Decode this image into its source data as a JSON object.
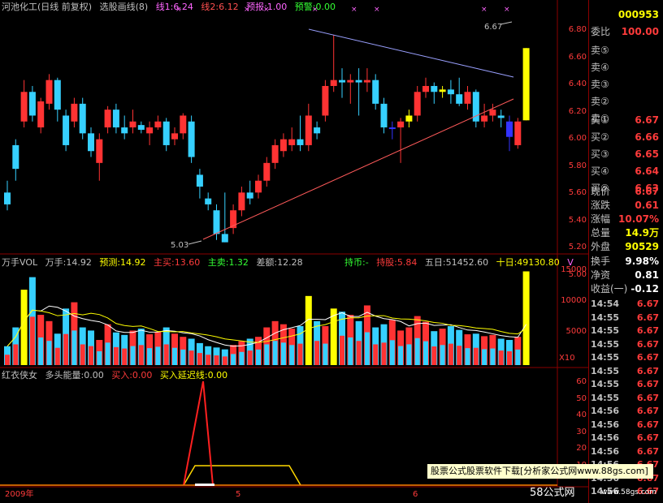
{
  "price_header": {
    "stock": "河池化工(日线 前复权)",
    "indicator": "选股画线(8)",
    "line1": "线1:6.24",
    "line2": "线2:6.12",
    "forecast": "预报:1.00",
    "warning": "预警:0.00"
  },
  "volume_header": {
    "title": "万手VOL",
    "vol": "万手:14.92",
    "pred": "预测:14.92",
    "main_buy": "主买:13.60",
    "main_sell": "主卖:1.32",
    "diff": "差额:12.28",
    "hold": "持币:-",
    "hold_unit": "持股:5.84",
    "ma5": "五日:51452.60",
    "ma10": "十日:49130.80",
    "v": "V"
  },
  "energy_header": {
    "title": "红衣侠女",
    "energy": "多头能量:0.00",
    "buy": "买入:0.00",
    "buy_delay": "买入延迟线:0.00"
  },
  "price_axis": [
    "6.80",
    "6.60",
    "6.40",
    "6.20",
    "6.00",
    "5.80",
    "5.60",
    "5.40",
    "5.20",
    "5.00"
  ],
  "volume_axis": [
    "15000",
    "10000",
    "5000"
  ],
  "volume_unit": "X10",
  "energy_axis": [
    "60",
    "50",
    "40",
    "30",
    "20",
    "10"
  ],
  "annotations": {
    "high": "6.67",
    "low": "5.03"
  },
  "time_axis": {
    "year": "2009年",
    "m5": "5",
    "m6": "6"
  },
  "sidebar": {
    "code": "000953",
    "ratio_label": "委比",
    "ratio_value": "100.00",
    "sells": [
      "卖⑤",
      "卖④",
      "卖③",
      "卖②",
      "卖①"
    ],
    "buys": [
      {
        "label": "买①",
        "value": "6.67"
      },
      {
        "label": "买②",
        "value": "6.66"
      },
      {
        "label": "买③",
        "value": "6.65"
      },
      {
        "label": "买④",
        "value": "6.64"
      },
      {
        "label": "买⑤",
        "value": "6.63"
      }
    ],
    "stats": [
      {
        "label": "现价",
        "value": "6.67"
      },
      {
        "label": "涨跌",
        "value": "0.61"
      },
      {
        "label": "涨幅",
        "value": "10.07%"
      },
      {
        "label": "总量",
        "value": "14.9万"
      },
      {
        "label": "外盘",
        "value": "90529"
      }
    ],
    "stats2": [
      {
        "label": "换手",
        "value": "9.98%"
      },
      {
        "label": "净资",
        "value": "0.81"
      },
      {
        "label": "收益(一)",
        "value": "-0.12"
      }
    ],
    "ticks": [
      {
        "time": "14:54",
        "price": "6.67"
      },
      {
        "time": "14:55",
        "price": "6.67"
      },
      {
        "time": "14:55",
        "price": "6.67"
      },
      {
        "time": "14:55",
        "price": "6.67"
      },
      {
        "time": "14:55",
        "price": "6.67"
      },
      {
        "time": "14:55",
        "price": "6.67"
      },
      {
        "time": "14:55",
        "price": "6.67"
      },
      {
        "time": "14:55",
        "price": "6.67"
      },
      {
        "time": "14:56",
        "price": "6.67"
      },
      {
        "time": "14:56",
        "price": "6.67"
      },
      {
        "time": "14:56",
        "price": "6.67"
      },
      {
        "time": "14:56",
        "price": "6.67"
      },
      {
        "time": "14:56",
        "price": "6.67"
      },
      {
        "time": "14:56",
        "price": "6.67"
      },
      {
        "time": "14:56",
        "price": "6.67"
      }
    ]
  },
  "watermark": "股票公式股票软件下载[分析家公式网www.88gs.com]",
  "site_logo": "58公式网",
  "site_url": "www.58gs.com",
  "colors": {
    "up": "#ff3333",
    "down": "#36d0ff",
    "special": "#ffff00",
    "line_red": "#ff5050",
    "line_blue": "#a0a8ff"
  },
  "chart_data": {
    "type": "candlestick",
    "price_range": [
      5.0,
      6.85
    ],
    "ohlc": [
      [
        5.45,
        5.35,
        5.55,
        5.3
      ],
      [
        5.85,
        5.65,
        5.9,
        5.55
      ],
      [
        6.05,
        6.3,
        6.4,
        6.0
      ],
      [
        6.3,
        6.1,
        6.35,
        6.05
      ],
      [
        6.0,
        6.22,
        6.25,
        5.95
      ],
      [
        6.2,
        6.4,
        6.45,
        6.15
      ],
      [
        6.4,
        6.15,
        6.42,
        6.05
      ],
      [
        6.1,
        5.85,
        6.15,
        5.8
      ],
      [
        6.05,
        6.2,
        6.25,
        6.0
      ],
      [
        6.2,
        5.95,
        6.25,
        5.9
      ],
      [
        5.95,
        5.8,
        6.0,
        5.75
      ],
      [
        5.7,
        5.9,
        5.95,
        5.55
      ],
      [
        6.0,
        6.15,
        6.18,
        5.95
      ],
      [
        6.15,
        6.0,
        6.2,
        5.95
      ],
      [
        6.0,
        5.95,
        6.1,
        5.9
      ],
      [
        6.0,
        6.05,
        6.15,
        5.95
      ],
      [
        6.02,
        5.98,
        6.05,
        5.95
      ],
      [
        5.95,
        6.0,
        6.05,
        5.85
      ],
      [
        6.0,
        6.05,
        6.1,
        5.98
      ],
      [
        6.05,
        5.85,
        6.08,
        5.8
      ],
      [
        5.9,
        5.95,
        6.0,
        5.85
      ],
      [
        5.95,
        6.1,
        6.12,
        5.9
      ],
      [
        6.05,
        5.75,
        6.1,
        5.7
      ],
      [
        5.6,
        5.5,
        5.65,
        5.4
      ],
      [
        5.4,
        5.35,
        5.45,
        5.3
      ],
      [
        5.3,
        5.1,
        5.35,
        5.05
      ],
      [
        5.1,
        5.03,
        5.45,
        5.03
      ],
      [
        5.15,
        5.3,
        5.35,
        5.1
      ],
      [
        5.3,
        5.45,
        5.5,
        5.25
      ],
      [
        5.45,
        5.4,
        5.55,
        5.35
      ],
      [
        5.45,
        5.55,
        5.6,
        5.4
      ],
      [
        5.55,
        5.7,
        5.75,
        5.5
      ],
      [
        5.7,
        5.85,
        5.9,
        5.65
      ],
      [
        5.8,
        5.9,
        5.95,
        5.75
      ],
      [
        5.85,
        5.9,
        6.0,
        5.8
      ],
      [
        5.9,
        5.85,
        6.1,
        5.8
      ],
      [
        5.85,
        6.1,
        6.2,
        5.8
      ],
      [
        6.0,
        5.95,
        6.05,
        5.9
      ],
      [
        6.1,
        6.35,
        6.4,
        6.05
      ],
      [
        6.35,
        6.4,
        6.78,
        6.3
      ],
      [
        6.4,
        6.38,
        6.5,
        6.25
      ],
      [
        6.38,
        6.4,
        6.45,
        6.2
      ],
      [
        6.4,
        6.38,
        6.5,
        6.1
      ],
      [
        6.38,
        6.4,
        6.5,
        6.3
      ],
      [
        6.4,
        6.2,
        6.45,
        6.15
      ],
      [
        6.2,
        6.0,
        6.25,
        5.95
      ],
      [
        6.0,
        6.0,
        6.05,
        5.9
      ],
      [
        6.0,
        6.05,
        6.08,
        5.7
      ],
      [
        6.05,
        6.1,
        6.15,
        6.0
      ],
      [
        6.1,
        6.3,
        6.35,
        6.05
      ],
      [
        6.3,
        6.35,
        6.42,
        6.25
      ],
      [
        6.35,
        6.3,
        6.38,
        6.2
      ],
      [
        6.3,
        6.32,
        6.35,
        6.25
      ],
      [
        6.32,
        6.28,
        6.4,
        6.2
      ],
      [
        6.28,
        6.2,
        6.42,
        6.18
      ],
      [
        6.2,
        6.3,
        6.35,
        6.15
      ],
      [
        6.3,
        6.05,
        6.32,
        6.0
      ],
      [
        6.05,
        6.1,
        6.2,
        6.0
      ],
      [
        6.1,
        6.15,
        6.2,
        6.05
      ],
      [
        6.1,
        6.08,
        6.15,
        6.0
      ],
      [
        6.05,
        5.92,
        6.1,
        5.8
      ],
      [
        5.85,
        6.05,
        6.08,
        5.82
      ],
      [
        6.06,
        6.67,
        6.67,
        6.06
      ]
    ],
    "volume": [
      3000,
      6000,
      12000,
      14000,
      8000,
      7000,
      5000,
      9000,
      10000,
      6000,
      5500,
      4000,
      6500,
      5200,
      4800,
      5500,
      5800,
      4900,
      5300,
      6000,
      5000,
      4500,
      4200,
      3500,
      3000,
      2800,
      2500,
      3200,
      3800,
      4200,
      4500,
      6000,
      7000,
      6500,
      5800,
      6200,
      11000,
      7000,
      6200,
      9000,
      8500,
      8000,
      7000,
      9500,
      6000,
      6500,
      7200,
      5500,
      6000,
      7800,
      6900,
      5400,
      5800,
      6200,
      5600,
      4900,
      5000,
      4600,
      4800,
      4200,
      4000,
      4500,
      14920
    ]
  }
}
